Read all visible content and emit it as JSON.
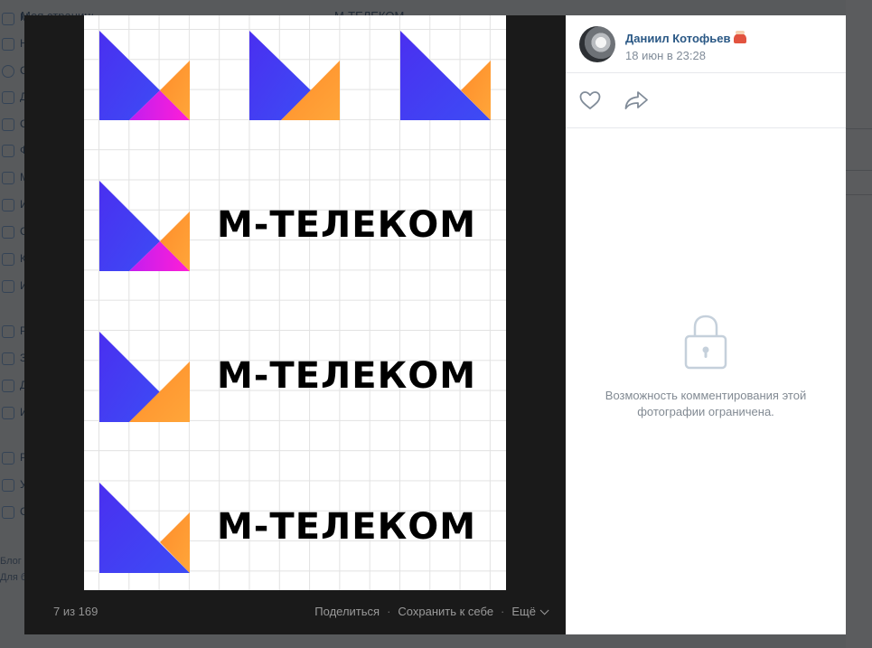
{
  "background_page": {
    "top_title": "Моя страница",
    "center_title": "М-ТЕЛЕКОМ",
    "sidebar_letters": [
      "М",
      "Н",
      "С",
      "Д",
      "С",
      "Ф",
      "М",
      "И",
      "С",
      "К",
      "И",
      "Р",
      "З",
      "Д",
      "И",
      "Р",
      "У",
      "С"
    ],
    "footer_lines": [
      "Блог",
      "Для бизнеса"
    ]
  },
  "photo": {
    "wordmark_rows": [
      "М-ТЕЛЕКОМ",
      "М-ТЕЛЕКОМ",
      "М-ТЕЛЕКОМ"
    ],
    "colors": {
      "violet": "#4a2ff0",
      "blue": "#3d4cf5",
      "magenta": "#e41fe8",
      "orange": "#ff9a2a"
    }
  },
  "footer": {
    "counter": "7 из 169",
    "share": "Поделиться",
    "save": "Сохранить к себе",
    "more": "Ещё",
    "separator": "·"
  },
  "side": {
    "author_name": "Даниил Котофьев",
    "date": "18 июн в 23:28",
    "icons": [
      "like-icon",
      "share-icon",
      "lock-icon"
    ],
    "restricted_line1": "Возможность комментирования этой",
    "restricted_line2": "фотографии ограничена.",
    "link_color": "#2a5885",
    "muted_color": "#828a93"
  }
}
